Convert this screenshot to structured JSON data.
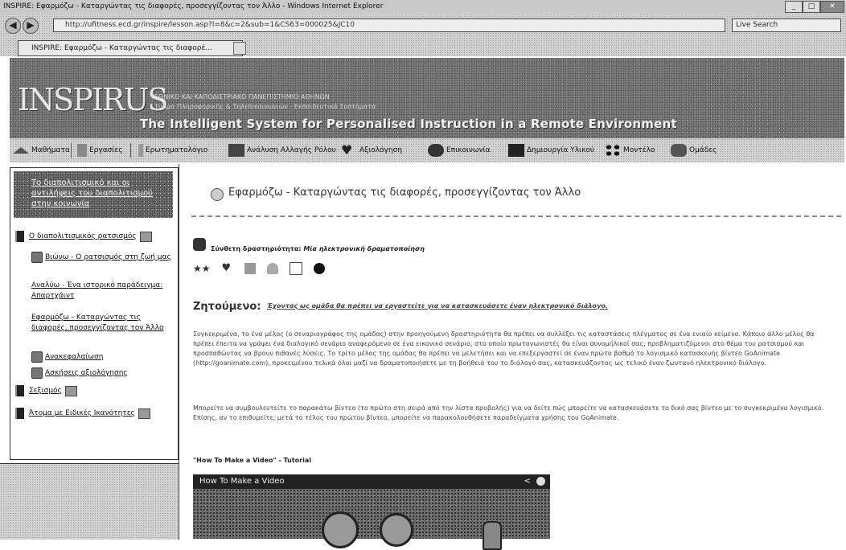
{
  "browser": {
    "window_title": "INSPIRE: Εφαρμόζω - Καταργώντας τις διαφορές, προσεγγίζοντας τον Άλλο - Windows Internet Explorer",
    "url": "http://ufitness.ecd.gr/inspire/lesson.asp?l=8&c=2&sub=1&CS63=000025&JC10",
    "search_placeholder": "Live Search",
    "tab_title": "INSPIRE: Εφαρμόζω - Καταργώντας τις διαφορέ..."
  },
  "header": {
    "logo": "INSPIRUS",
    "university_line1": "ΕΘΝΙΚΟ ΚΑΙ ΚΑΠΟΔΙΣΤΡΙΑΚΟ ΠΑΝΕΠΙΣΤΗΜΙΟ ΑΘΗΝΩΝ",
    "university_line2": "Τμήμα Πληροφορικής & Τηλεπικοινωνιών - Εκπαιδευτικά Συστήματα",
    "tagline": "The Intelligent System for Personalised Instruction in a Remote Environment"
  },
  "menu": {
    "items": [
      {
        "label": "Μαθήματα",
        "icon": "home-icon"
      },
      {
        "label": "Εργασίες",
        "icon": "tasks-icon"
      },
      {
        "label": "Ερωτηματολόγιο",
        "icon": "questionnaire-icon"
      },
      {
        "label": "Ανάλυση Αλλαγής Ρόλου",
        "icon": "analysis-icon"
      },
      {
        "label": "Αξιολόγηση",
        "icon": "heart-icon"
      },
      {
        "label": "Επικοινωνία",
        "icon": "communication-icon"
      },
      {
        "label": "Δημιουργία Υλικού",
        "icon": "create-material-icon"
      },
      {
        "label": "Μοντέλο",
        "icon": "model-icon"
      },
      {
        "label": "Ομάδες",
        "icon": "groups-icon"
      }
    ]
  },
  "sidebar": {
    "heading": "Το διαπολιτισμικό και οι αντιλήψεις του διαπολιτισμού στην κοινωνία",
    "items": [
      {
        "label": "Ο διαπολιτισμικός ρατσισμός"
      },
      {
        "label": "Βιώνω - Ο ρατσισμός στη ζωή μας"
      },
      {
        "label": "Αναλύω - Ένα ιστορικό παράδειγμα: Απαρτχάιντ"
      },
      {
        "label": "Εφαρμόζω - Καταργώντας τις διαφορές, προσεγγίζοντας τον Άλλο"
      },
      {
        "label": "Ανακεφαλαίωση"
      },
      {
        "label": "Ασκήσεις αξιολόγησης"
      },
      {
        "label": "Σεξισμός"
      },
      {
        "label": "Άτομα με Ειδικές Ικανότητες"
      }
    ]
  },
  "content": {
    "page_title": "Εφαρμόζω - Καταργώντας τις διαφορές, προσεγγίζοντας τον Άλλο",
    "activity_type_label": "Σύνθετη δραστηριότητα:",
    "activity_type_value": "Μία ηλεκτρονική δραματοποίηση",
    "stars": "★★",
    "requirement_label": "Ζητούμενο:",
    "requirement_text": "Έχοντας ως ομάδα θα πρέπει να εργαστείτε για να κατασκευάσετε έναν ηλεκτρονικό διάλογο.",
    "paragraph1": "Συγκεκριμένα, το ένα μέλος (ο σεναριογράφος της ομάδας) στην προηγούμενη δραστηριότητα θα πρέπει να συλλέξει τις καταστάσεις πλέγματος σε ένα ενιαίο κείμενο. Κάποιο άλλο μέλος θα πρέπει έπειτα να γράψει ένα διαλογικό σενάριο αναφερόμενο σε ένα εικονικό σενάριο, στο οποίο πρωταγωνιστές θα είναι συνομήλικοί σας, προβληματιζόμενοι στο θέμα του ρατσισμού και προσπαθώντας να βρουν πιθανές λύσεις. Το τρίτο μέλος της ομάδας θα πρέπει να μελετήσει και να επεξεργαστεί σε έναν πρώτο βαθμό το λογισμικό κατασκευής βίντεο GoAnimate (http://goanimate.com), προκειμένου τελικά όλοι μαζί να δραματοποιήσετε με τη βοήθειά του το διάλογό σας, κατασκευάζοντας ως τελικό έναν ζωντανό ηλεκτρονικό διάλογο.",
    "paragraph2": "Μπορείτε να συμβουλευτείτε το παρακάτω βίντεο (το πρώτο στη σειρά από την λίστα προβολής) για να δείτε πώς μπορείτε να κατασκευάσετε το δικό σας βίντεο με το συγκεκριμένο λογισμικό. Επίσης, αν το επιθυμείτε, μετά το τέλος του πρώτου βίντεο, μπορείτε να παρακολουθήσετε παραδείγματα χρήσης του GoAnimate.",
    "video_heading": "\"How To Make a Video\" - Tutorial",
    "video_title": "How To Make a Video"
  }
}
